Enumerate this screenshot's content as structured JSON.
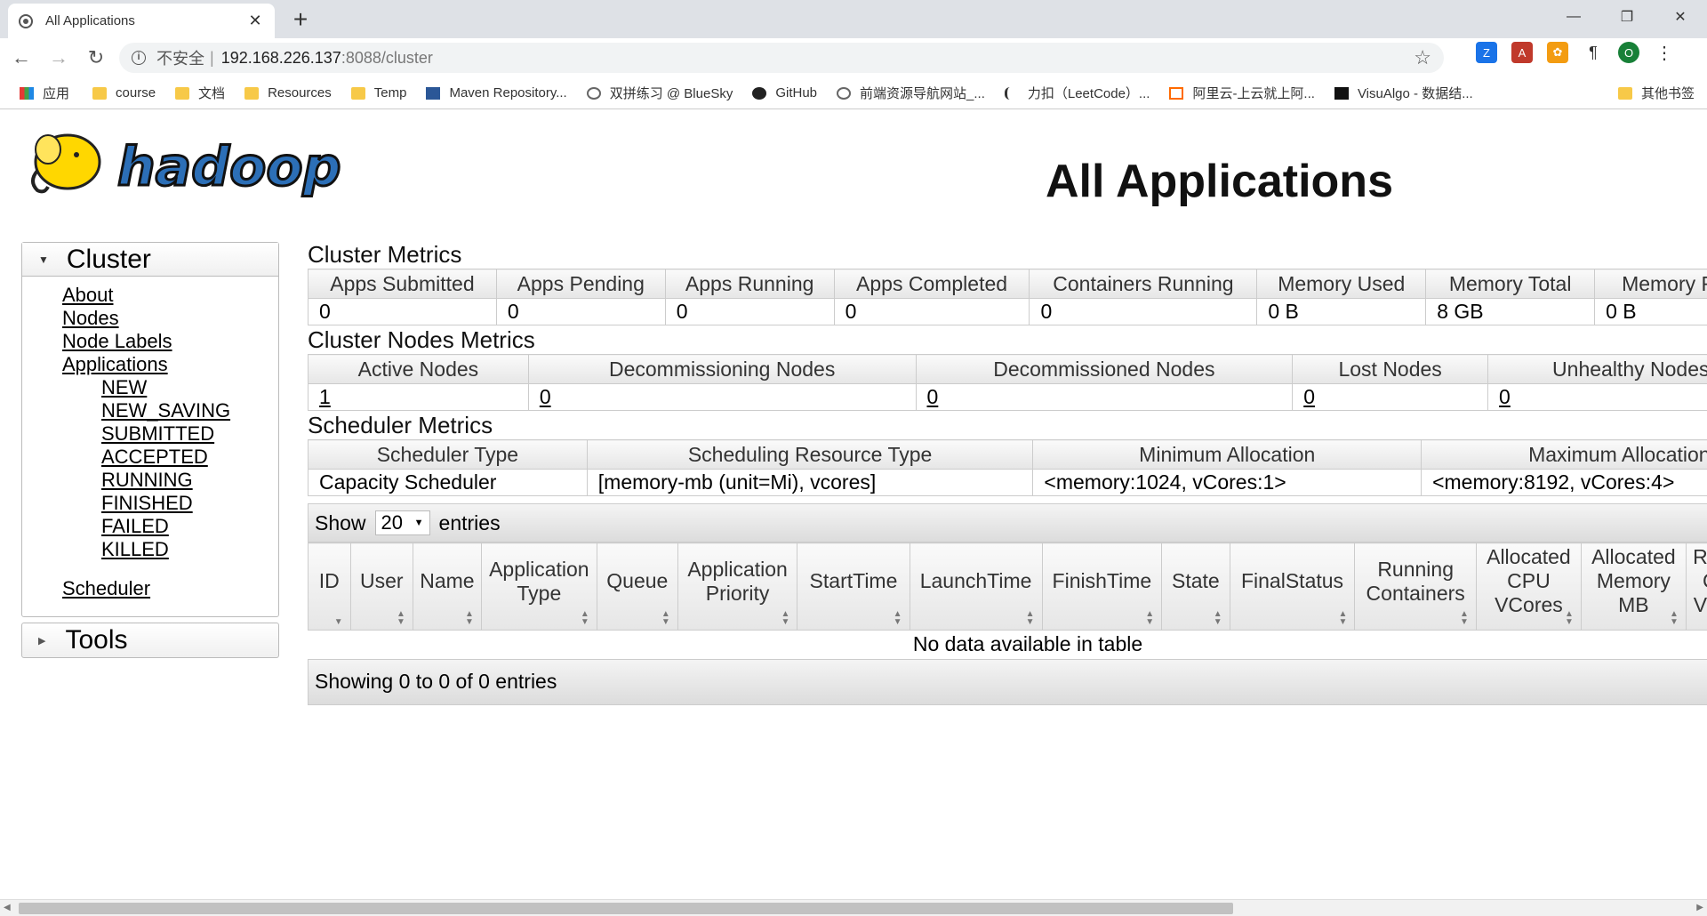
{
  "browser": {
    "tab_title": "All Applications",
    "tab_close": "✕",
    "new_tab": "+",
    "address": {
      "insecure_label": "不安全",
      "separator": "|",
      "host": "192.168.226.137",
      "path": ":8088/cluster"
    },
    "bookmarks": [
      {
        "label": "应用",
        "icon": "apps-grid-icon"
      },
      {
        "label": "course",
        "icon": "folder-icon"
      },
      {
        "label": "文档",
        "icon": "folder-icon"
      },
      {
        "label": "Resources",
        "icon": "folder-icon"
      },
      {
        "label": "Temp",
        "icon": "folder-icon"
      },
      {
        "label": "Maven Repository...",
        "icon": "maven-icon"
      },
      {
        "label": "双拼练习 @ BlueSky",
        "icon": "globe-icon"
      },
      {
        "label": "GitHub",
        "icon": "github-icon"
      },
      {
        "label": "前端资源导航网站_...",
        "icon": "globe-icon"
      },
      {
        "label": "力扣（LeetCode）...",
        "icon": "leetcode-icon"
      },
      {
        "label": "阿里云-上云就上阿...",
        "icon": "aliyun-icon"
      },
      {
        "label": "VisuAlgo - 数据结...",
        "icon": "visualgo-icon"
      }
    ],
    "other_bookmarks": "其他书签",
    "profile_initial": "O"
  },
  "header": {
    "logo_text": "hadoop",
    "title": "All Applications"
  },
  "nav": {
    "cluster_label": "Cluster",
    "links": [
      "About",
      "Nodes",
      "Node Labels",
      "Applications"
    ],
    "app_states": [
      "NEW",
      "NEW_SAVING",
      "SUBMITTED",
      "ACCEPTED",
      "RUNNING",
      "FINISHED",
      "FAILED",
      "KILLED"
    ],
    "scheduler": "Scheduler",
    "tools_label": "Tools"
  },
  "cluster_metrics": {
    "title": "Cluster Metrics",
    "headers": [
      "Apps Submitted",
      "Apps Pending",
      "Apps Running",
      "Apps Completed",
      "Containers Running",
      "Memory Used",
      "Memory Total",
      "Memory R"
    ],
    "values": [
      "0",
      "0",
      "0",
      "0",
      "0",
      "0 B",
      "8 GB",
      "0 B"
    ]
  },
  "node_metrics": {
    "title": "Cluster Nodes Metrics",
    "headers": [
      "Active Nodes",
      "Decommissioning Nodes",
      "Decommissioned Nodes",
      "Lost Nodes",
      "Unhealthy Nodes"
    ],
    "values": [
      "1",
      "0",
      "0",
      "0",
      "0"
    ]
  },
  "scheduler_metrics": {
    "title": "Scheduler Metrics",
    "headers": [
      "Scheduler Type",
      "Scheduling Resource Type",
      "Minimum Allocation",
      "Maximum Allocation"
    ],
    "values": [
      "Capacity Scheduler",
      "[memory-mb (unit=Mi), vcores]",
      "<memory:1024, vCores:1>",
      "<memory:8192, vCores:4>"
    ]
  },
  "apps_table": {
    "show_label": "Show",
    "entries_value": "20",
    "entries_label": "entries",
    "columns": [
      "ID",
      "User",
      "Name",
      "Application Type",
      "Queue",
      "Application Priority",
      "StartTime",
      "LaunchTime",
      "FinishTime",
      "State",
      "FinalStatus",
      "Running Containers",
      "Allocated CPU VCores",
      "Allocated Memory MB",
      "Rese CP VCor"
    ],
    "empty_message": "No data available in table",
    "footer": "Showing 0 to 0 of 0 entries"
  }
}
